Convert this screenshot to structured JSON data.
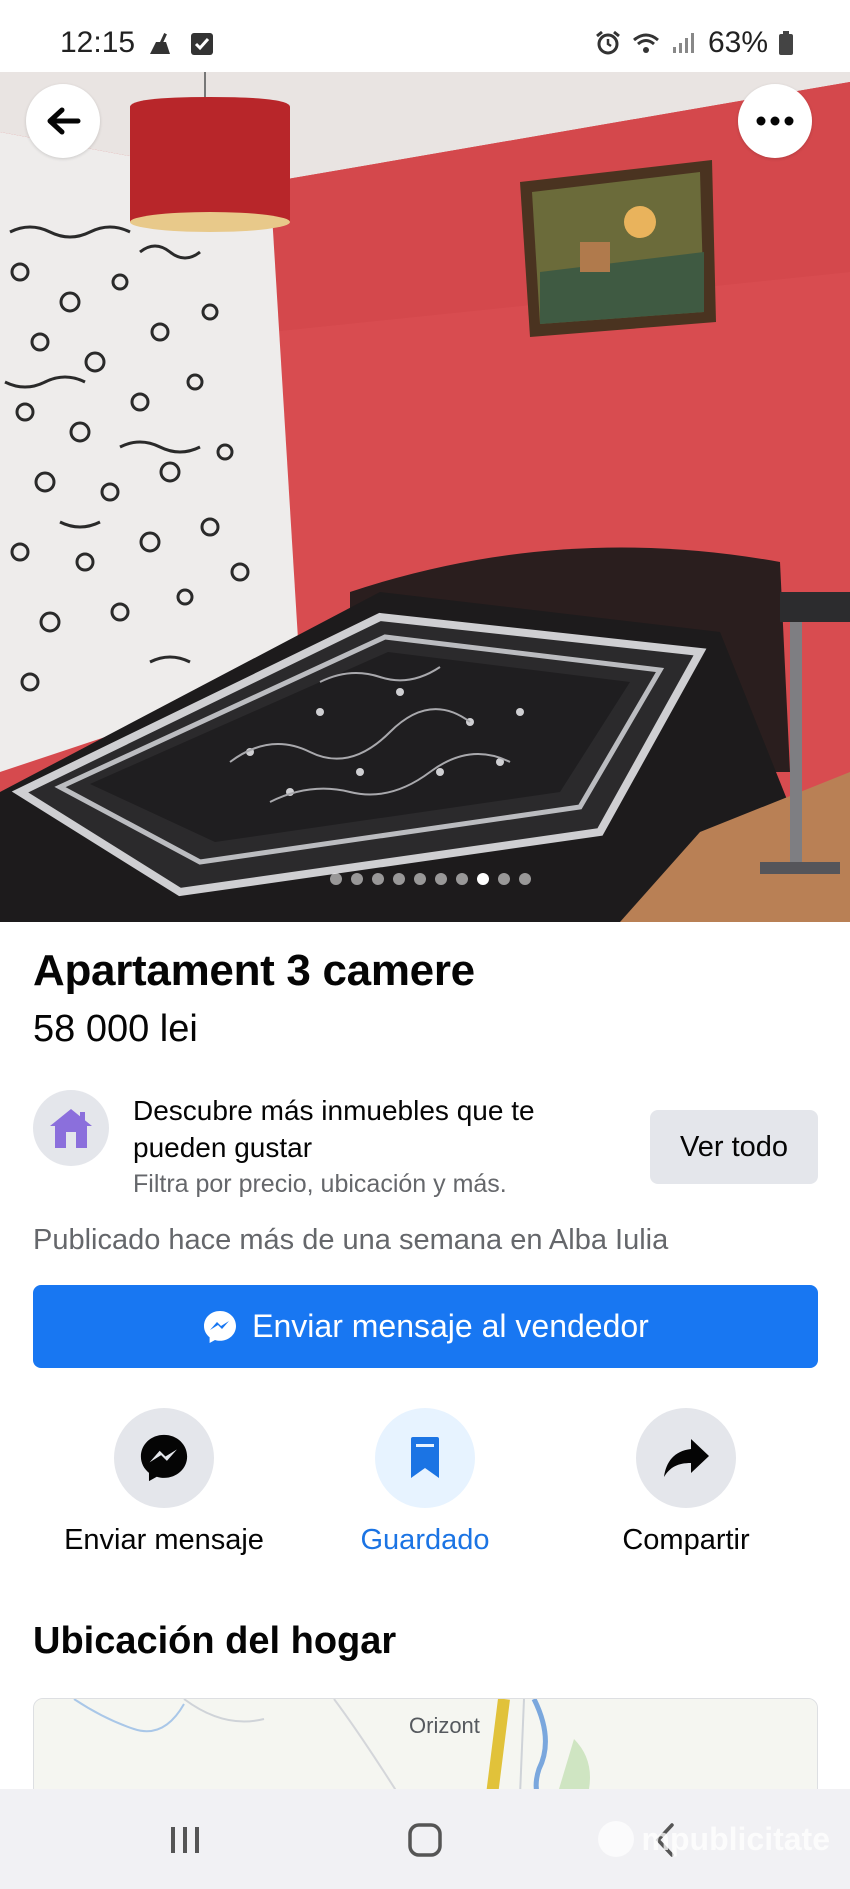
{
  "status_bar": {
    "time": "12:15",
    "battery": "63%",
    "icons": [
      "cleaner-icon",
      "checkbox-icon",
      "alarm-icon",
      "wifi-icon",
      "signal-icon",
      "battery-icon"
    ]
  },
  "photo": {
    "description_icon": "bedroom-photo",
    "page_count": 10,
    "active_index": 7
  },
  "listing": {
    "title": "Apartament 3 camere",
    "price": "58 000 lei"
  },
  "promo": {
    "title": "Descubre más inmuebles que te pueden gustar",
    "subtitle": "Filtra por precio, ubicación y más.",
    "button": "Ver todo"
  },
  "published": "Publicado hace más de una semana en Alba Iulia",
  "send_seller_button": "Enviar mensaje al vendedor",
  "actions": [
    {
      "label": "Enviar mensaje",
      "icon": "messenger-icon"
    },
    {
      "label": "Guardado",
      "icon": "bookmark-icon"
    },
    {
      "label": "Compartir",
      "icon": "share-icon"
    }
  ],
  "location_section": {
    "title": "Ubicación del hogar",
    "map_label": "Orizont"
  },
  "watermark": "mpublicitate",
  "colors": {
    "accent": "#1877f2",
    "saved": "#1b74e4",
    "secondary_text": "#65676b",
    "button_gray": "#e4e6eb"
  }
}
